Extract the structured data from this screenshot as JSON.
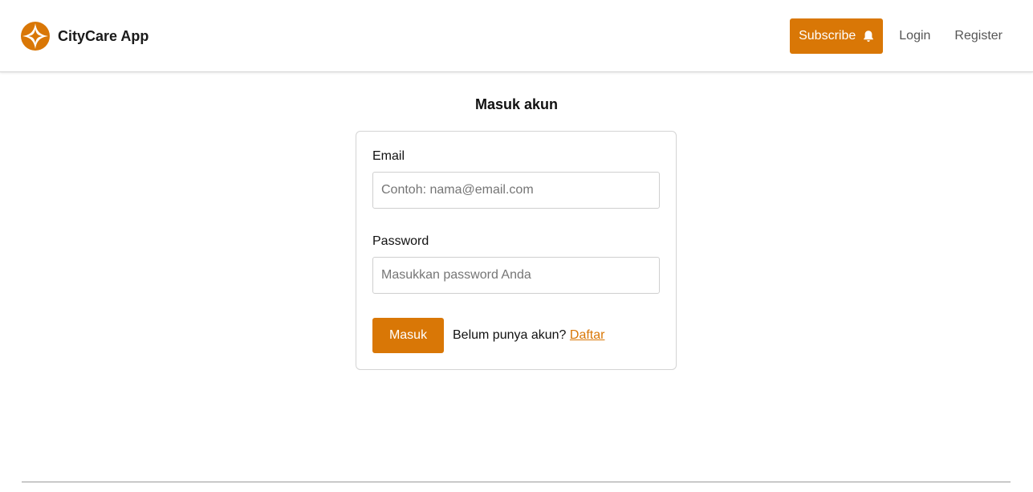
{
  "header": {
    "brand_name": "CityCare App",
    "logo_icon": "compass-star-icon",
    "subscribe_label": "Subscribe",
    "subscribe_icon": "bell-icon",
    "login_label": "Login",
    "register_label": "Register"
  },
  "login": {
    "title": "Masuk akun",
    "email_label": "Email",
    "email_value": "",
    "email_placeholder": "Contoh: nama@email.com",
    "password_label": "Password",
    "password_value": "",
    "password_placeholder": "Masukkan password Anda",
    "submit_label": "Masuk",
    "register_prompt": "Belum punya akun?",
    "register_link": "Daftar"
  },
  "colors": {
    "accent": "#d97706",
    "text": "#111111",
    "muted": "#555555",
    "border": "#d4d4d4"
  }
}
